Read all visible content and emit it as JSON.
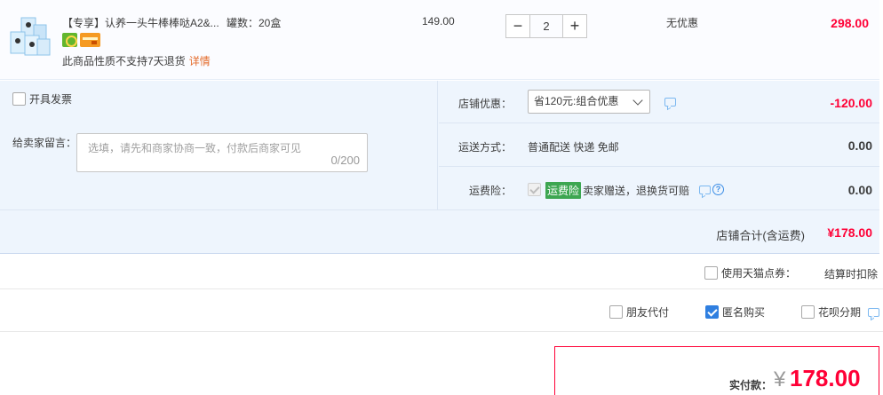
{
  "product": {
    "title": "【专享】认养一头牛棒棒哒A2&...",
    "spec": "罐数：20盒",
    "return_note": "此商品性质不支持7天退货",
    "details_link": "详情",
    "unit_price": "149.00",
    "quantity": "2",
    "qty_minus": "−",
    "qty_plus": "+",
    "discount": "无优惠",
    "line_total": "298.00",
    "thumbnail_alt": "milk box",
    "colors": {
      "price_red": "#ff0036"
    }
  },
  "invoice": {
    "label": "开具发票"
  },
  "message": {
    "label": "给卖家留言：",
    "placeholder": "选填，请先和商家协商一致，付款后商家可见",
    "count": "0/200"
  },
  "shop_discount": {
    "label": "店铺优惠：",
    "selected": "省120元:组合优惠",
    "amount": "-120.00"
  },
  "shipping": {
    "label": "运送方式：",
    "value": "普通配送 快递 免邮",
    "amount": "0.00"
  },
  "insurance": {
    "label": "运费险：",
    "tag": "运费险",
    "value": "卖家赠送，退换货可赔",
    "help": "?",
    "amount": "0.00"
  },
  "shop_total": {
    "label": "店铺合计(含运费)",
    "value": "¥178.00"
  },
  "points": {
    "label": "使用天猫点券：",
    "note": "结算时扣除"
  },
  "options": {
    "friend_pay": "朋友代付",
    "anonymous": "匿名购买",
    "huabei": "花呗分期"
  },
  "payment": {
    "label": "实付款：",
    "currency": "¥",
    "value": "178.00"
  }
}
